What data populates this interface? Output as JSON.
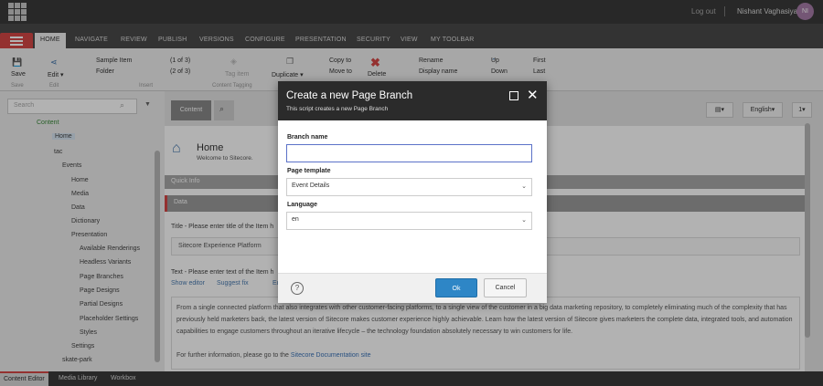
{
  "topbar": {
    "logout": "Log out",
    "user": "Nishant Vaghasiya",
    "avatar_initials": "NI"
  },
  "menu": {
    "tabs": [
      "HOME",
      "NAVIGATE",
      "REVIEW",
      "PUBLISH",
      "VERSIONS",
      "CONFIGURE",
      "PRESENTATION",
      "SECURITY",
      "VIEW",
      "MY TOOLBAR"
    ]
  },
  "ribbon": {
    "save": "Save",
    "edit": "Edit ▾",
    "sample_item": "Sample Item",
    "sample_count": "(1 of 3)",
    "folder": "Folder",
    "folder_count": "(2 of 3)",
    "insert_group": "Insert",
    "tag_item": "Tag item",
    "tagging_group": "Content Tagging",
    "duplicate": "Duplicate ▾",
    "copy_to": "Copy to",
    "move_to": "Move to",
    "delete": "Delete",
    "rename": "Rename",
    "display_name": "Display name",
    "up": "Up",
    "down": "Down",
    "first": "First",
    "last": "Last",
    "save_group": "Save",
    "edit_group": "Edit"
  },
  "sidebar": {
    "search_placeholder": "Search",
    "tree": [
      "Content",
      "Home",
      "tac",
      "Events",
      "Home",
      "Media",
      "Data",
      "Dictionary",
      "Presentation",
      "Available Renderings",
      "Headless Variants",
      "Page Branches",
      "Page Designs",
      "Partial Designs",
      "Placeholder Settings",
      "Styles",
      "Settings",
      "skate-park"
    ]
  },
  "content": {
    "tab": "Content",
    "lang": "English▾",
    "title": "Home",
    "subtitle": "Welcome to Sitecore.",
    "quick_info": "Quick Info",
    "data": "Data",
    "title_label": "Title - Please enter title of the Item h",
    "title_value": "Sitecore Experience Platform",
    "text_label": "Text - Please enter text of the Item h",
    "show_editor": "Show editor",
    "suggest_fix": "Suggest fix",
    "ed": "Ed",
    "body": "From a single connected platform that also integrates with other customer-facing platforms, to a single view of the customer in a big data marketing repository, to completely eliminating much of the complexity that has previously held marketers back, the latest version of Sitecore makes customer experience highly achievable. Learn how the latest version of Sitecore gives marketers the complete data, integrated tools, and automation capabilities to engage customers throughout an iterative lifecycle – the technology foundation absolutely necessary to win customers for life.",
    "further": "For further information, please go to the",
    "link": "Sitecore Documentation site"
  },
  "bottom_tabs": [
    "Content Editor",
    "Media Library",
    "Workbox"
  ],
  "dialog": {
    "title": "Create a new Page Branch",
    "subtitle": "This script creates a new Page Branch",
    "branch_label": "Branch name",
    "branch_value": "",
    "template_label": "Page template",
    "template_value": "Event Details",
    "language_label": "Language",
    "language_value": "en",
    "ok": "Ok",
    "cancel": "Cancel"
  }
}
